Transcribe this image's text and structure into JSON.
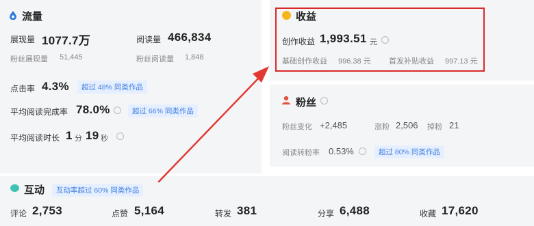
{
  "traffic": {
    "title": "流量",
    "impressions_label": "展现量",
    "impressions_value": "1077.7万",
    "reads_label": "阅读量",
    "reads_value": "466,834",
    "fan_impressions_label": "粉丝展现量",
    "fan_impressions_value": "51,445",
    "fan_reads_label": "粉丝阅读量",
    "fan_reads_value": "1,848",
    "ctr_label": "点击率",
    "ctr_value": "4.3%",
    "ctr_badge": "超过 48% 同类作品",
    "completion_label": "平均阅读完成率",
    "completion_value": "78.0%",
    "completion_badge": "超过 66% 同类作品",
    "duration_label": "平均阅读时长",
    "duration_min": "1",
    "duration_min_unit": "分",
    "duration_sec": "19",
    "duration_sec_unit": "秒"
  },
  "income": {
    "title": "收益",
    "creation_label": "创作收益",
    "creation_value": "1,993.51",
    "creation_unit": "元",
    "basic_label": "基础创作收益",
    "basic_value": "996.38 元",
    "bonus_label": "首发补贴收益",
    "bonus_value": "997.13 元"
  },
  "fans": {
    "title": "粉丝",
    "change_label": "粉丝变化",
    "change_value": "+2,485",
    "gain_label": "涨粉",
    "gain_value": "2,506",
    "lost_label": "掉粉",
    "lost_value": "21",
    "conversion_label": "阅读转粉率",
    "conversion_value": "0.53%",
    "conversion_badge": "超过 80% 同类作品"
  },
  "interaction": {
    "title": "互动",
    "badge": "互动率超过 60% 同类作品",
    "comments_label": "评论",
    "comments_value": "2,753",
    "likes_label": "点赞",
    "likes_value": "5,164",
    "forwards_label": "转发",
    "forwards_value": "381",
    "shares_label": "分享",
    "shares_value": "6,488",
    "favorites_label": "收藏",
    "favorites_value": "17,620"
  },
  "colors": {
    "highlight_box": "#d9282a",
    "arrow": "#e23a33",
    "badge_text": "#3f7fe0",
    "traffic_icon": "#2f7de1",
    "income_icon": "#f5b51c",
    "fans_icon": "#e0533e",
    "interaction_icon": "#3cc3b4"
  }
}
